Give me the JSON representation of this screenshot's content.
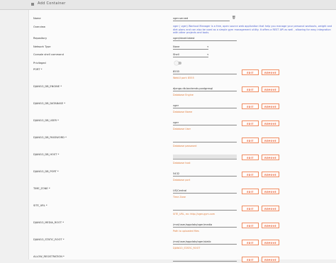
{
  "header": {
    "title": "Add Container"
  },
  "name": {
    "label": "Name",
    "value": "vger-served"
  },
  "overview": {
    "label": "Overview",
    "text": "vger ( vger) Workout Manager is a free, open source web        application that help you manage your personal workouts, weight and diet plans and can also be used as a simple gym management utility. It offers a REST API as well                 , allowing for easy integration with other projects and tools."
  },
  "repository": {
    "label": "Repository",
    "value": "vger/devel:latest"
  },
  "network_type": {
    "label": "Network Type",
    "value": "None"
  },
  "console_shell": {
    "label": "Console shell command",
    "value": "Shell"
  },
  "privileged": {
    "label": "Privileged"
  },
  "buttons": {
    "edit": "EDIT",
    "remove": "REMOVE"
  },
  "fields": [
    {
      "label": "PORT *",
      "value": "8555",
      "help": "WebUI port: 8555"
    },
    {
      "label": "DJANGO_DB_ENGINE *",
      "value": "django.db.backends.postgresql",
      "help": "Database Engine"
    },
    {
      "label": "DJANGO_DB_DATABASE *",
      "value": "vger",
      "help": "Database Name"
    },
    {
      "label": "DJANGO_DB_USER *",
      "value": "vger",
      "help": "Database User"
    },
    {
      "label": "DJANGO_DB_PASSWORD *",
      "value": "",
      "help": "Database password"
    },
    {
      "label": "DJANGO_DB_HOST *",
      "value": "",
      "help": "Database host"
    },
    {
      "label": "DJANGO_DB_PORT *",
      "value": "5432",
      "help": "Database port"
    },
    {
      "label": "TIME_ZONE *",
      "value": "US/Central",
      "help": "Time Zone"
    },
    {
      "label": "SITE_URL *",
      "value": "",
      "help": "SITE_URL, ex: http://vger-gym.com"
    },
    {
      "label": "DJANGO_MEDIA_ROOT *",
      "value": "/mnt/user/appdata/vger/media",
      "help": "Path to uploaded files"
    },
    {
      "label": "DJANGO_STATIC_ROOT *",
      "value": "/mnt/user/appdata/vger/static",
      "help": "DJANGO_STATIC_ROOT"
    },
    {
      "label": "ALLOW_REGISTRATION *",
      "value": "",
      "help": ""
    }
  ]
}
